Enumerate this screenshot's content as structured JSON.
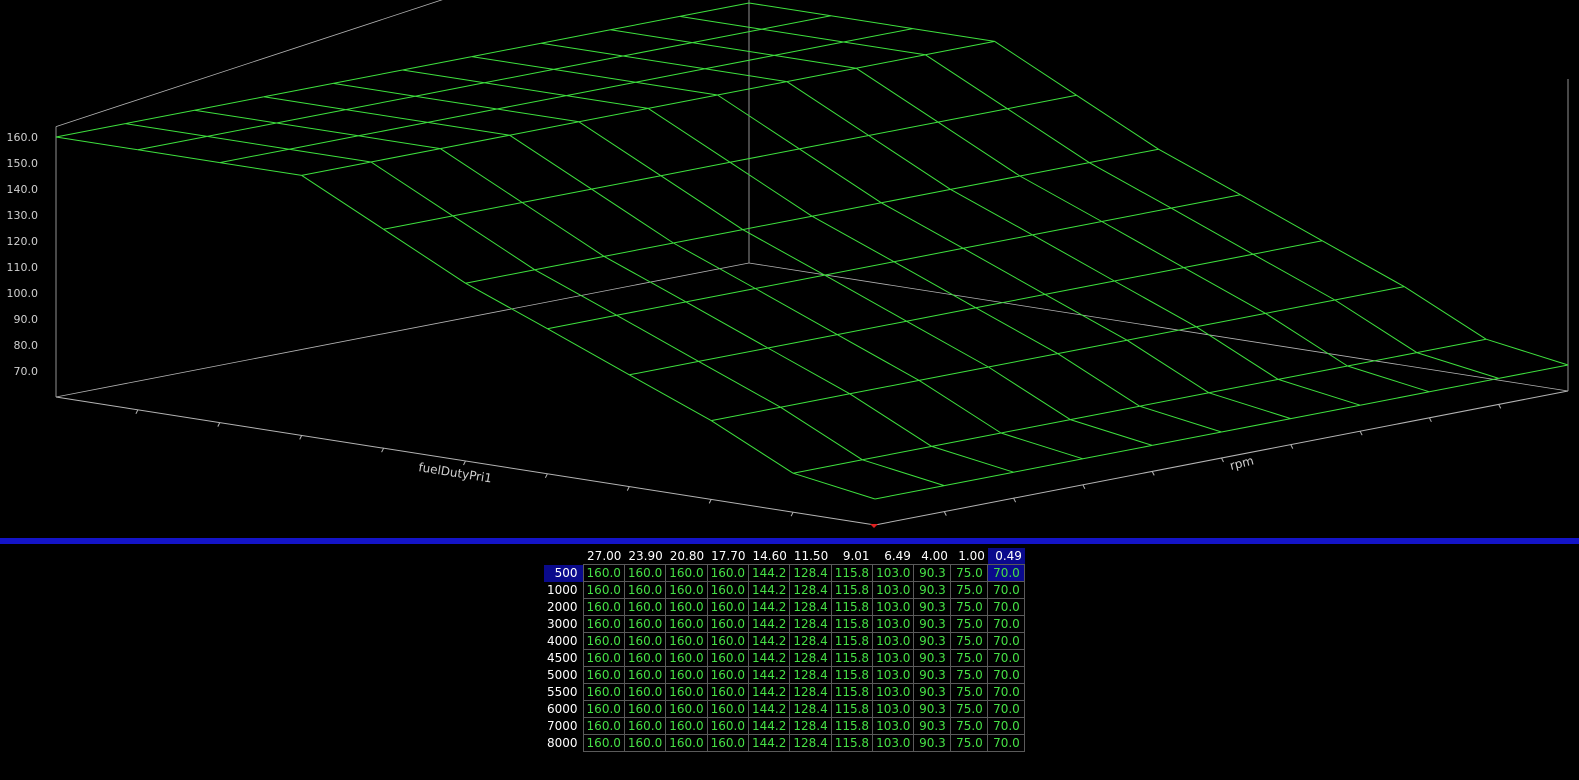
{
  "surface": {
    "x_axis_label": "fuelDutyPri1",
    "y_axis_label": "rpm",
    "z_tick_labels": [
      "160.0",
      "150.0",
      "140.0",
      "130.0",
      "120.0",
      "110.0",
      "100.0",
      "90.0",
      "80.0",
      "70.0"
    ],
    "colors": {
      "mesh": "#3ee03e",
      "axis": "#b4b4b4",
      "divider": "#1414c8",
      "selected": "#0a0a8c",
      "marker": "#e02020"
    }
  },
  "table": {
    "columns": [
      "27.00",
      "23.90",
      "20.80",
      "17.70",
      "14.60",
      "11.50",
      "9.01",
      "6.49",
      "4.00",
      "1.00",
      "0.49"
    ],
    "rows": [
      {
        "label": "500",
        "values": [
          "160.0",
          "160.0",
          "160.0",
          "160.0",
          "144.2",
          "128.4",
          "115.8",
          "103.0",
          "90.3",
          "75.0",
          "70.0"
        ]
      },
      {
        "label": "1000",
        "values": [
          "160.0",
          "160.0",
          "160.0",
          "160.0",
          "144.2",
          "128.4",
          "115.8",
          "103.0",
          "90.3",
          "75.0",
          "70.0"
        ]
      },
      {
        "label": "2000",
        "values": [
          "160.0",
          "160.0",
          "160.0",
          "160.0",
          "144.2",
          "128.4",
          "115.8",
          "103.0",
          "90.3",
          "75.0",
          "70.0"
        ]
      },
      {
        "label": "3000",
        "values": [
          "160.0",
          "160.0",
          "160.0",
          "160.0",
          "144.2",
          "128.4",
          "115.8",
          "103.0",
          "90.3",
          "75.0",
          "70.0"
        ]
      },
      {
        "label": "4000",
        "values": [
          "160.0",
          "160.0",
          "160.0",
          "160.0",
          "144.2",
          "128.4",
          "115.8",
          "103.0",
          "90.3",
          "75.0",
          "70.0"
        ]
      },
      {
        "label": "4500",
        "values": [
          "160.0",
          "160.0",
          "160.0",
          "160.0",
          "144.2",
          "128.4",
          "115.8",
          "103.0",
          "90.3",
          "75.0",
          "70.0"
        ]
      },
      {
        "label": "5000",
        "values": [
          "160.0",
          "160.0",
          "160.0",
          "160.0",
          "144.2",
          "128.4",
          "115.8",
          "103.0",
          "90.3",
          "75.0",
          "70.0"
        ]
      },
      {
        "label": "5500",
        "values": [
          "160.0",
          "160.0",
          "160.0",
          "160.0",
          "144.2",
          "128.4",
          "115.8",
          "103.0",
          "90.3",
          "75.0",
          "70.0"
        ]
      },
      {
        "label": "6000",
        "values": [
          "160.0",
          "160.0",
          "160.0",
          "160.0",
          "144.2",
          "128.4",
          "115.8",
          "103.0",
          "90.3",
          "75.0",
          "70.0"
        ]
      },
      {
        "label": "7000",
        "values": [
          "160.0",
          "160.0",
          "160.0",
          "160.0",
          "144.2",
          "128.4",
          "115.8",
          "103.0",
          "90.3",
          "75.0",
          "70.0"
        ]
      },
      {
        "label": "8000",
        "values": [
          "160.0",
          "160.0",
          "160.0",
          "160.0",
          "144.2",
          "128.4",
          "115.8",
          "103.0",
          "90.3",
          "75.0",
          "70.0"
        ]
      }
    ],
    "selected": {
      "row": 0,
      "col": 10
    }
  }
}
